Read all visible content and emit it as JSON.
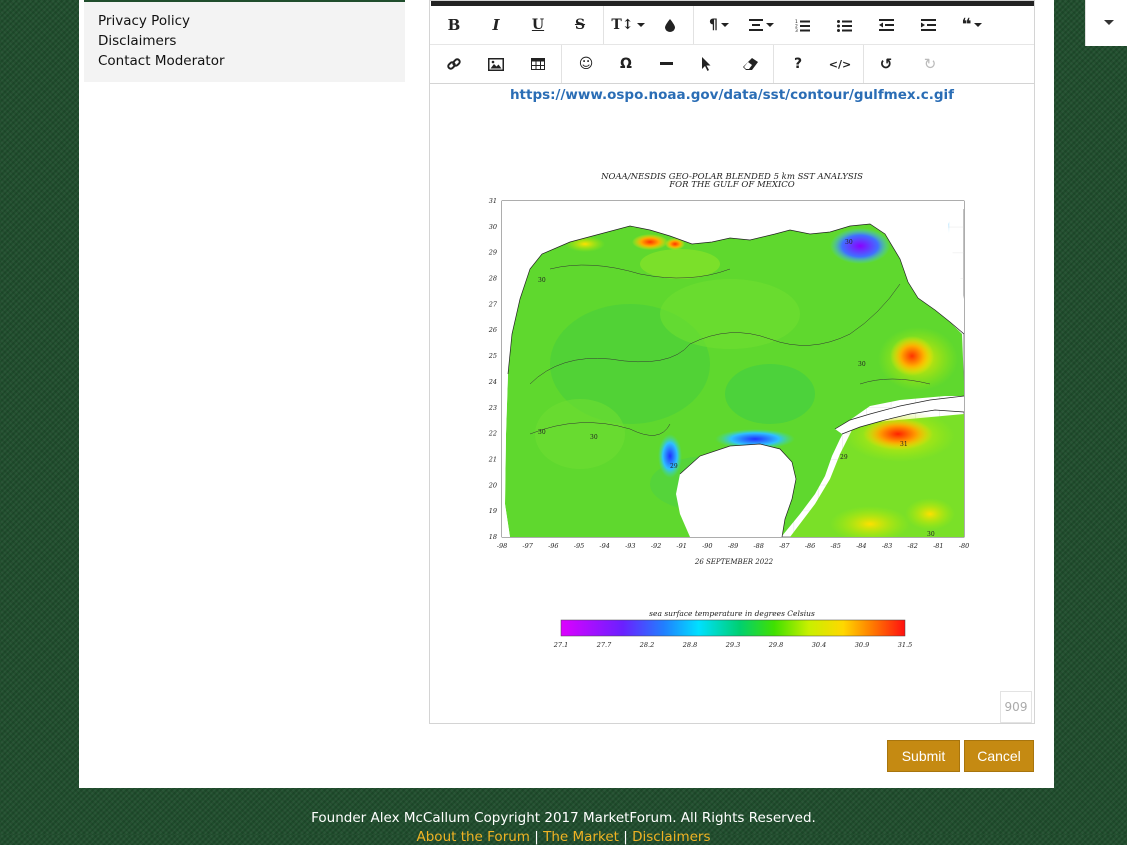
{
  "sidebar": {
    "links": [
      "Privacy Policy",
      "Disclaimers",
      "Contact Moderator"
    ]
  },
  "editor": {
    "toolbar": {
      "row1": [
        "bold-icon",
        "italic-icon",
        "underline-icon",
        "strikethrough-icon",
        "font-size-icon",
        "color-icon",
        "paragraph-icon",
        "align-icon",
        "ordered-list-icon",
        "unordered-list-icon",
        "outdent-icon",
        "indent-icon",
        "quote-icon"
      ],
      "row2": [
        "link-icon",
        "image-icon",
        "table-icon",
        "emoji-icon",
        "special-char-icon",
        "horizontal-rule-icon",
        "select-icon",
        "clear-format-icon",
        "help-icon",
        "code-view-icon",
        "undo-icon",
        "redo-icon"
      ]
    },
    "link_text": "https://www.ospo.noaa.gov/data/sst/contour/gulfmex.c.gif",
    "image": {
      "title_line1": "NOAA/NESDIS GEO-POLAR BLENDED 5 km SST ANALYSIS",
      "title_line2": "FOR THE GULF OF MEXICO",
      "date": "26 SEPTEMBER 2022",
      "lat_ticks": [
        "31",
        "30",
        "29",
        "28",
        "27",
        "26",
        "25",
        "24",
        "23",
        "22",
        "21",
        "20",
        "19",
        "18"
      ],
      "lon_ticks": [
        "-98",
        "-97",
        "-96",
        "-95",
        "-94",
        "-93",
        "-92",
        "-91",
        "-90",
        "-89",
        "-88",
        "-87",
        "-86",
        "-85",
        "-84",
        "-83",
        "-82",
        "-81",
        "-80"
      ],
      "colorbar_title": "sea surface temperature in degrees Celsius",
      "colorbar_ticks": [
        "27.1",
        "27.7",
        "28.2",
        "28.8",
        "29.3",
        "29.8",
        "30.4",
        "30.9",
        "31.5"
      ],
      "contour_labels": [
        "30",
        "30",
        "30",
        "30",
        "29",
        "29",
        "30",
        "31",
        "30"
      ]
    },
    "char_count": "909"
  },
  "buttons": {
    "submit": "Submit",
    "cancel": "Cancel"
  },
  "footer": {
    "copyright": "Founder Alex McCallum Copyright 2017 MarketForum. All Rights Reserved.",
    "links": [
      "About the Forum",
      "The Market",
      "Disclaimers"
    ],
    "separator": "|"
  },
  "colors": {
    "accent": "#c58a12",
    "link": "#2a6db5",
    "background": "#1f4d2c"
  }
}
